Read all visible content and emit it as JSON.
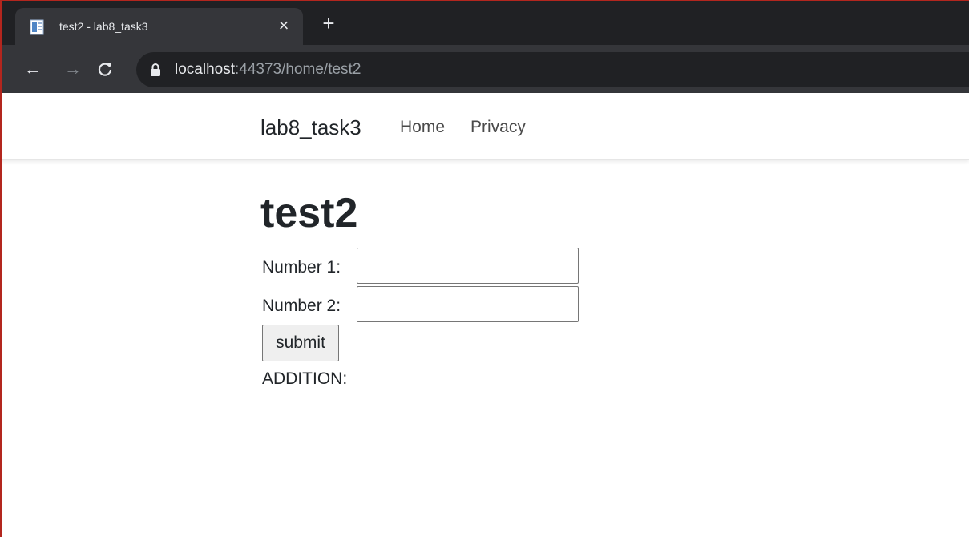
{
  "browser": {
    "tab_title": "test2 - lab8_task3",
    "tab_close": "×",
    "new_tab": "+",
    "url_host": "localhost",
    "url_rest": ":44373/home/test2",
    "back_glyph": "←",
    "forward_glyph": "→",
    "reload_glyph": "C"
  },
  "navbar": {
    "brand": "lab8_task3",
    "links": [
      "Home",
      "Privacy"
    ]
  },
  "main": {
    "title": "test2",
    "number1_label": "Number 1:",
    "number1_value": "",
    "number2_label": "Number 2:",
    "number2_value": "",
    "submit_label": "submit",
    "result_label": "ADDITION:"
  },
  "colors": {
    "chrome_bg": "#202124",
    "toolbar_bg": "#35363a",
    "text": "#212529",
    "edge_accent": "#b3261e"
  },
  "icons": [
    "page-favicon-icon",
    "close-icon",
    "plus-icon",
    "back-arrow-icon",
    "forward-arrow-icon",
    "reload-icon",
    "lock-icon"
  ]
}
